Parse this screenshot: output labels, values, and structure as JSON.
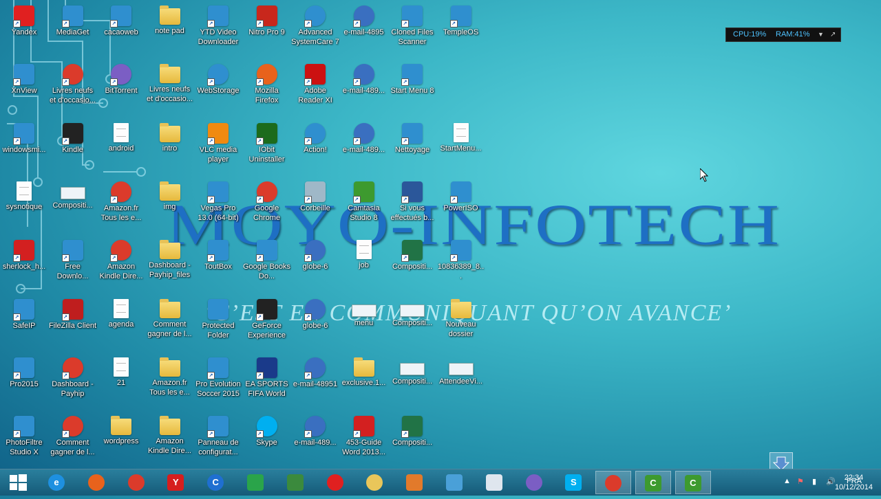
{
  "wallpaper": {
    "title": "MOYO-INFOTECH",
    "slogan": "‘C’EST EN COMMUNIQUANT QU’ON AVANCE’"
  },
  "widget": {
    "cpu": "CPU:19%",
    "ram": "RAM:41%"
  },
  "colors": {
    "accent": "#1e6fc4",
    "taskbar": "#1c6b8b",
    "widget_text": "#4fc3ff"
  },
  "desktop": {
    "columns": [
      [
        "Yandex",
        "XnView",
        "windowsmi...",
        "sysnotique",
        "sherlock_h...",
        "SafeIP",
        "Pro2015",
        "PhotoFiltre Studio X"
      ],
      [
        "MediaGet",
        "Livres neufs et d'occasio...",
        "Kindle",
        "Compositi...",
        "Free Downlo...",
        "FileZilla Client",
        "Dashboard - Payhip",
        "Comment gagner de l..."
      ],
      [
        "cacaoweb",
        "BitTorrent",
        "android",
        "Amazon.fr Tous les e...",
        "Amazon Kindle Dire...",
        "agenda",
        "21",
        "wordpress"
      ],
      [
        "note pad",
        "Livres neufs et d'occasio...",
        "intro",
        "img",
        "Dashboard - Payhip_files",
        "Comment gagner de l...",
        "Amazon.fr Tous les e...",
        "Amazon Kindle Dire..."
      ],
      [
        "YTD Video Downloader",
        "WebStorage",
        "VLC media player",
        "Vegas Pro 13.0 (64-bit)",
        "ToutBox",
        "Protected Folder",
        "Pro Evolution Soccer 2015",
        "Panneau de configurat..."
      ],
      [
        "Nitro Pro 9",
        "Mozilla Firefox",
        "IObit Uninstaller",
        "Google Chrome",
        "Google Books Do...",
        "GeForce Experience",
        "EA SPORTS FIFA World",
        "Skype"
      ],
      [
        "Advanced SystemCare 7",
        "Adobe Reader XI",
        "Action!",
        "Corbeille",
        "globe-6",
        "globe-6",
        "e-mail-48951",
        "e-mail-489..."
      ],
      [
        "e-mail-4895",
        "e-mail-489...",
        "e-mail-489...",
        "Camtasia Studio 8",
        "job",
        "menu",
        "exclusive.1...",
        "453-Guide Word 2013..."
      ],
      [
        "Cloned Files Scanner",
        "Start Menu 8",
        "Nettoyage",
        "Si vous effectués b...",
        "Compositi...",
        "Compositi...",
        "Compositi...",
        "Compositi..."
      ],
      [
        "TempleOS",
        "",
        "StartMenu...",
        "PowerISO",
        "10836389_8...",
        "Nouveau dossier",
        "AttendeeVi...",
        ""
      ]
    ],
    "icons": [
      [
        "yandex-icon",
        "xnview-icon",
        "windows-media-icon",
        "file-icon",
        "pdf-icon",
        "safeip-icon",
        "game-icon",
        "photofiltre-icon"
      ],
      [
        "mediaget-icon",
        "chrome-icon",
        "kindle-icon",
        "window-file-icon",
        "free-download-icon",
        "filezilla-icon",
        "chrome-icon",
        "chrome-icon"
      ],
      [
        "cacaoweb-icon",
        "bittorrent-icon",
        "file-icon",
        "chrome-icon",
        "chrome-icon",
        "file-icon",
        "file-icon",
        "folder-icon"
      ],
      [
        "folder-icon",
        "folder-icon",
        "folder-icon",
        "folder-icon",
        "folder-icon",
        "folder-icon",
        "folder-icon",
        "folder-icon"
      ],
      [
        "ytd-icon",
        "webstorage-icon",
        "vlc-icon",
        "vegas-icon",
        "toutbox-icon",
        "protected-folder-icon",
        "game-icon",
        "control-panel-icon"
      ],
      [
        "nitro-icon",
        "firefox-icon",
        "iobit-icon",
        "chrome-icon",
        "google-books-icon",
        "geforce-icon",
        "ea-sports-icon",
        "skype-icon"
      ],
      [
        "systemcare-icon",
        "adobe-reader-icon",
        "action-icon",
        "recycle-bin-icon",
        "globe-icon",
        "globe-icon",
        "globe-icon",
        "globe-icon"
      ],
      [
        "globe-icon",
        "globe-icon",
        "globe-icon",
        "camtasia-icon",
        "file-icon",
        "window-file-icon",
        "zip-folder-icon",
        "pdf-icon"
      ],
      [
        "cloned-files-icon",
        "start-menu-icon",
        "cleanup-icon",
        "word-icon",
        "excel-icon",
        "window-file-icon",
        "window-file-icon",
        "excel-icon"
      ],
      [
        "templeos-icon",
        "",
        "file-icon",
        "poweriso-icon",
        "image-icon",
        "folder-icon",
        "window-file-icon",
        ""
      ]
    ]
  },
  "taskbar": {
    "apps": [
      {
        "name": "internet-explorer-icon",
        "glyph": "e",
        "color": "#1e90e0"
      },
      {
        "name": "firefox-icon",
        "glyph": "",
        "color": "#e8621c"
      },
      {
        "name": "chrome-icon",
        "glyph": "",
        "color": "#db3b2b"
      },
      {
        "name": "yandex-icon",
        "glyph": "Y",
        "color": "#d61e1e"
      },
      {
        "name": "advanced-systemcare-icon",
        "glyph": "C",
        "color": "#1f6fd1"
      },
      {
        "name": "store-icon",
        "glyph": "",
        "color": "#2aa44a"
      },
      {
        "name": "utility-icon",
        "glyph": "",
        "color": "#3b8a3d"
      },
      {
        "name": "yandex-browser-icon",
        "glyph": "",
        "color": "#e02020"
      },
      {
        "name": "file-explorer-icon",
        "glyph": "",
        "color": "#e9c65a"
      },
      {
        "name": "metro-apps-icon",
        "glyph": "",
        "color": "#e27a2b"
      },
      {
        "name": "network-icon",
        "glyph": "",
        "color": "#4aa0d8"
      },
      {
        "name": "document-icon",
        "glyph": "",
        "color": "#dfe6ee"
      },
      {
        "name": "bittorrent-icon",
        "glyph": "",
        "color": "#7b5ec4"
      },
      {
        "name": "skype-icon",
        "glyph": "S",
        "color": "#00aff0"
      },
      {
        "name": "chrome-icon",
        "glyph": "",
        "color": "#db3b2b"
      },
      {
        "name": "camtasia-icon",
        "glyph": "C",
        "color": "#3d9a2f"
      },
      {
        "name": "camtasia-recorder-icon",
        "glyph": "C",
        "color": "#3d9a2f"
      }
    ],
    "tray": {
      "language": "FRA",
      "time": "22:34",
      "date": "10/12/2014"
    }
  }
}
